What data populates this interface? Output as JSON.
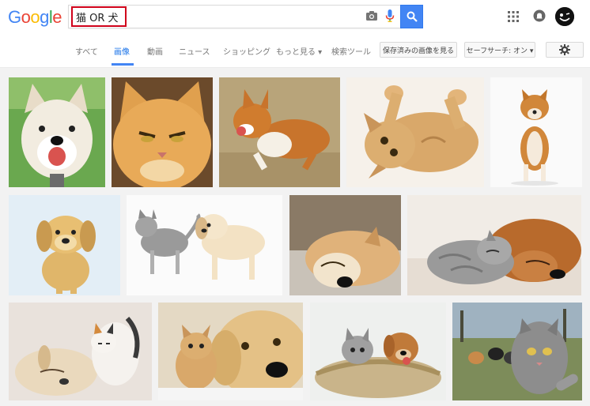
{
  "logo": {
    "text": "Google",
    "letters": [
      {
        "ch": "G",
        "color": "#4285F4"
      },
      {
        "ch": "o",
        "color": "#EA4335"
      },
      {
        "ch": "o",
        "color": "#FBBC05"
      },
      {
        "ch": "g",
        "color": "#4285F4"
      },
      {
        "ch": "l",
        "color": "#34A853"
      },
      {
        "ch": "e",
        "color": "#EA4335"
      }
    ]
  },
  "search": {
    "query": "猫 OR 犬"
  },
  "nav": {
    "items": [
      {
        "label": "すべて",
        "active": false
      },
      {
        "label": "画像",
        "active": true
      },
      {
        "label": "動画",
        "active": false
      },
      {
        "label": "ニュース",
        "active": false
      },
      {
        "label": "ショッピング",
        "active": false
      },
      {
        "label": "もっと見る ▾",
        "active": false
      },
      {
        "label": "検索ツール",
        "active": false
      }
    ],
    "saved_images_label": "保存済みの画像を見る",
    "safesearch_label": "セーフサーチ: オン ▾"
  },
  "icons": [
    "camera-icon",
    "microphone-icon",
    "search-icon",
    "apps-grid-icon",
    "notifications-icon",
    "avatar",
    "gear-icon"
  ],
  "images": [
    {
      "name": "shiba-dog-smiling"
    },
    {
      "name": "orange-cat-grumpy"
    },
    {
      "name": "corgi-running"
    },
    {
      "name": "kitten-playing-on-back"
    },
    {
      "name": "shiba-dog-standing"
    },
    {
      "name": "puppy-sitting"
    },
    {
      "name": "kitten-and-puppy-walking"
    },
    {
      "name": "dog-sleeping"
    },
    {
      "name": "cat-and-dog-sleeping-together"
    },
    {
      "name": "puppy-and-kitten-sleeping"
    },
    {
      "name": "kitten-with-golden-retriever"
    },
    {
      "name": "kitten-and-puppy-in-basket"
    },
    {
      "name": "cat-selfie-with-dogs"
    }
  ],
  "colors": {
    "search_blue": "#4285F4",
    "highlight_red": "#D0021B"
  }
}
